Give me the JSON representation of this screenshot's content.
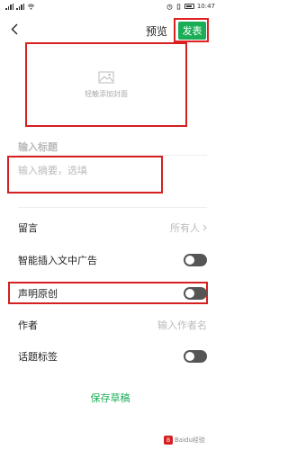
{
  "status_bar": {
    "time": "10:47"
  },
  "header": {
    "preview_label": "预览",
    "publish_label": "发表"
  },
  "cover": {
    "placeholder": "轻触添加封面"
  },
  "title_input": {
    "placeholder": "输入标题"
  },
  "summary_input": {
    "placeholder": "输入摘要，选填"
  },
  "settings": {
    "comments": {
      "label": "留言",
      "value": "所有人"
    },
    "smart_ads": {
      "label": "智能插入文中广告",
      "enabled": false
    },
    "declare_original": {
      "label": "声明原创",
      "enabled": false
    },
    "author": {
      "label": "作者",
      "placeholder": "输入作者名"
    },
    "topic_tags": {
      "label": "话题标签",
      "enabled": false
    }
  },
  "footer": {
    "save_draft_label": "保存草稿"
  },
  "colors": {
    "accent": "#1aad56",
    "highlight": "#d42020",
    "toggle_off": "#555555"
  },
  "watermark": {
    "text": "Baidu经验"
  }
}
